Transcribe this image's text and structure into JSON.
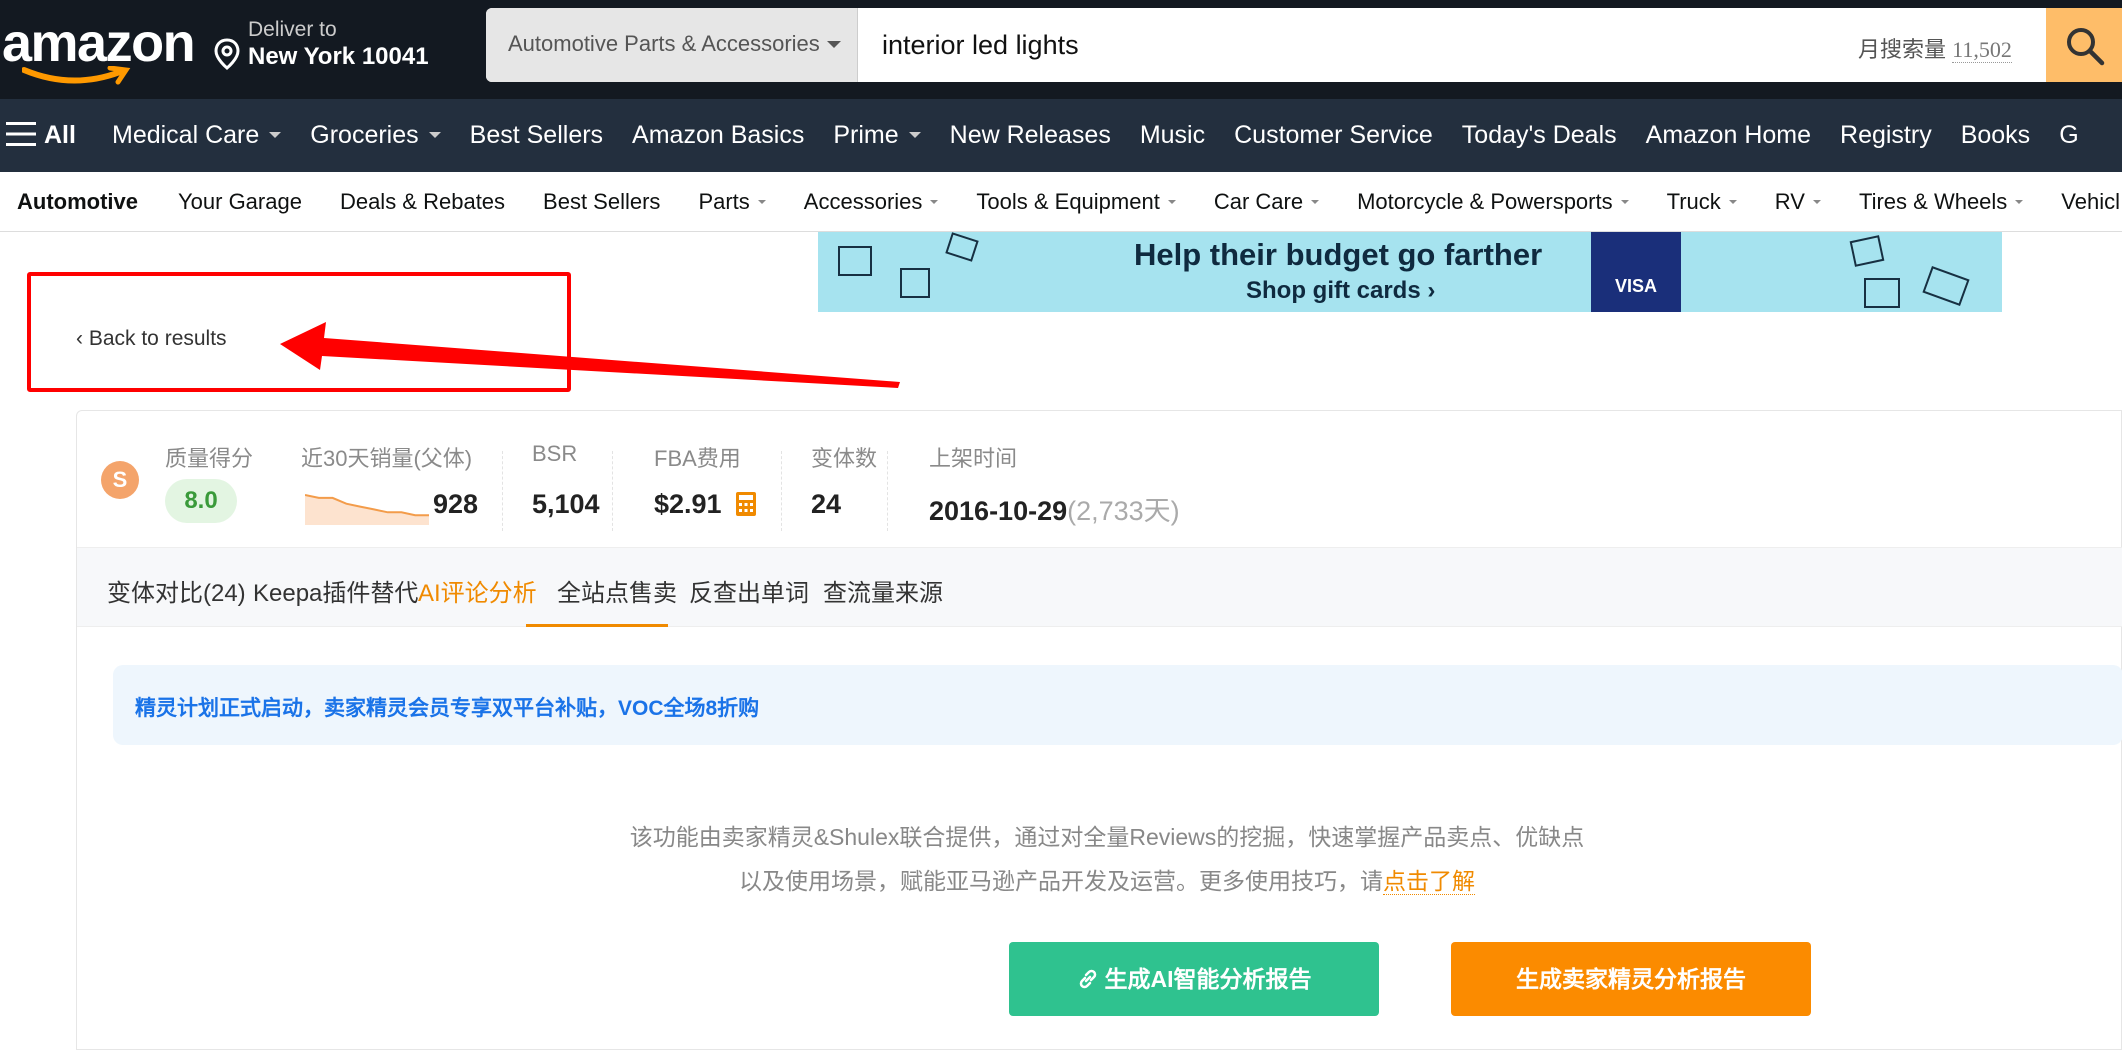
{
  "header": {
    "logo": "amazon",
    "deliver_line1": "Deliver to",
    "deliver_line2": "New York 10041",
    "search_department": "Automotive Parts & Accessories",
    "search_value": "interior led lights",
    "monthly_search_label": "月搜索量",
    "monthly_search_value": "11,502"
  },
  "nav": {
    "all_label": "All",
    "items": [
      {
        "label": "Medical Care",
        "dropdown": true
      },
      {
        "label": "Groceries",
        "dropdown": true
      },
      {
        "label": "Best Sellers",
        "dropdown": false
      },
      {
        "label": "Amazon Basics",
        "dropdown": false
      },
      {
        "label": "Prime",
        "dropdown": true
      },
      {
        "label": "New Releases",
        "dropdown": false
      },
      {
        "label": "Music",
        "dropdown": false
      },
      {
        "label": "Customer Service",
        "dropdown": false
      },
      {
        "label": "Today's Deals",
        "dropdown": false
      },
      {
        "label": "Amazon Home",
        "dropdown": false
      },
      {
        "label": "Registry",
        "dropdown": false
      },
      {
        "label": "Books",
        "dropdown": false
      },
      {
        "label": "G",
        "dropdown": false
      }
    ]
  },
  "subnav": {
    "items": [
      {
        "label": "Automotive",
        "bold": true,
        "dropdown": false
      },
      {
        "label": "Your Garage",
        "dropdown": false
      },
      {
        "label": "Deals & Rebates",
        "dropdown": false
      },
      {
        "label": "Best Sellers",
        "dropdown": false
      },
      {
        "label": "Parts",
        "dropdown": true
      },
      {
        "label": "Accessories",
        "dropdown": true
      },
      {
        "label": "Tools & Equipment",
        "dropdown": true
      },
      {
        "label": "Car Care",
        "dropdown": true
      },
      {
        "label": "Motorcycle & Powersports",
        "dropdown": true
      },
      {
        "label": "Truck",
        "dropdown": true
      },
      {
        "label": "RV",
        "dropdown": true
      },
      {
        "label": "Tires & Wheels",
        "dropdown": true
      },
      {
        "label": "Vehicl",
        "dropdown": false
      }
    ]
  },
  "banner": {
    "title": "Help their budget go farther",
    "cta": "Shop gift cards ›",
    "card_text": "VISA"
  },
  "back_to_results": "‹  Back to results",
  "plugin": {
    "metrics": {
      "quality_label": "质量得分",
      "quality_value": "8.0",
      "sales_label": "近30天销量(父体)",
      "sales_value": "928",
      "sales_trend": [
        9,
        8,
        8,
        6,
        5,
        4,
        3,
        3,
        2,
        2
      ],
      "bsr_label": "BSR",
      "bsr_value": "5,104",
      "fba_label": "FBA费用",
      "fba_value": "$2.91",
      "variants_label": "变体数",
      "variants_value": "24",
      "listed_label": "上架时间",
      "listed_value": "2016-10-29",
      "listed_days": "(2,733天)"
    },
    "tabs": [
      {
        "label": "变体对比(24)",
        "active": false
      },
      {
        "label": "Keepa插件替代",
        "active": false
      },
      {
        "label": "AI评论分析",
        "active": true
      },
      {
        "label": "全站点售卖",
        "active": false
      },
      {
        "label": "反查出单词",
        "active": false
      },
      {
        "label": "查流量来源",
        "active": false
      }
    ],
    "notice": "精灵计划正式启动，卖家精灵会员专享双平台补贴，VOC全场8折购",
    "desc_line1": "该功能由卖家精灵&Shulex联合提供，通过对全量Reviews的挖掘，快速掌握产品卖点、优缺点",
    "desc_line2": "以及使用场景，赋能亚马逊产品开发及运营。更多使用技巧，请",
    "desc_link": "点击了解",
    "btn_ai": "生成AI智能分析报告",
    "btn_seller": "生成卖家精灵分析报告"
  },
  "colors": {
    "header_bg": "#131921",
    "nav_bg": "#232f3e",
    "search_button": "#febd69",
    "accent_orange": "#f08a00",
    "green_button": "#2fc28f",
    "annotation_red": "#ff0000"
  }
}
